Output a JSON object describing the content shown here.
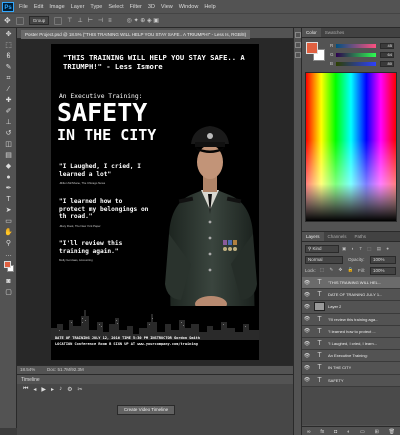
{
  "app": {
    "logo": "Ps",
    "menu": [
      "File",
      "Edit",
      "Image",
      "Layer",
      "Type",
      "Select",
      "Filter",
      "3D",
      "View",
      "Window",
      "Help"
    ]
  },
  "options": {
    "tool_icon": "move-tool-icon",
    "auto_select": "Group"
  },
  "document": {
    "tab_label": "Poster Project.psd @ 18.5% (\"THIS TRAINING WILL HELP YOU STAY SAFE.. A TRIUMPH!\" - Less Is, RGB/8)",
    "zoom": "18.54%",
    "doc_size": "Doc: 51.7M/92.3M"
  },
  "poster": {
    "quote": "\"THIS TRAINING WILL HELP YOU STAY SAFE.. A TRIUMPH!\"  - Less Ismore",
    "subtitle": "An Executive Training:",
    "title_line1": "SAFETY",
    "title_line2": "IN THE CITY",
    "testimonials": [
      {
        "text": "\"I Laughed, I cried, I learned a lot\"",
        "attribution": "-Milton McShane, The Chicago News"
      },
      {
        "text": "\"I learned how to protect my belongings on th road.\"",
        "attribution": "-Mary Rook, The New York Paper"
      },
      {
        "text": "\"I'll review this training again.\"",
        "attribution": "Molly Gonzaas, Accounting"
      }
    ],
    "details_line1": "DATE OF TRAINING JULY 12, 2016 TIME 5:30 PM INSTRUCTOR Gordon Smith",
    "details_line2": "LOCATION Conference Room B SIGN UP AT www.yourcompany.com/training"
  },
  "timeline": {
    "title": "Timeline",
    "create_button": "Create Video Timeline"
  },
  "color_panel": {
    "tabs": [
      "Color",
      "Swatches"
    ],
    "fg_color": "#e06040",
    "bg_color": "#ffffff",
    "sliders": [
      {
        "label": "R",
        "value": "45"
      },
      {
        "label": "G",
        "value": "64"
      },
      {
        "label": "B",
        "value": "80"
      }
    ]
  },
  "layers_panel": {
    "tabs": [
      "Layers",
      "Channels",
      "Paths"
    ],
    "filter_label": "Kind",
    "blend_mode": "Normal",
    "opacity_label": "Opacity:",
    "opacity": "100%",
    "lock_label": "Lock:",
    "fill_label": "Fill:",
    "fill": "100%",
    "layers": [
      {
        "name": "\"THIS TRAINING WILL HEL...",
        "kind": "text",
        "selected": true
      },
      {
        "name": "DATE OF TRAINING JULY 1...",
        "kind": "text",
        "selected": false
      },
      {
        "name": "Layer 2",
        "kind": "image",
        "selected": false
      },
      {
        "name": "\"I'll review this training aga...",
        "kind": "text",
        "selected": false
      },
      {
        "name": "\"I learned how to protect ...",
        "kind": "text",
        "selected": false
      },
      {
        "name": "\"I Laughed, I cried, I learn...",
        "kind": "text",
        "selected": false
      },
      {
        "name": "An Executive Training:",
        "kind": "text",
        "selected": false
      },
      {
        "name": "IN THE CITY",
        "kind": "text",
        "selected": false
      },
      {
        "name": "SAFETY",
        "kind": "text",
        "selected": false
      }
    ],
    "footer_icons": [
      "link-icon",
      "fx-icon",
      "mask-icon",
      "adjustment-icon",
      "folder-icon",
      "new-layer-icon",
      "trash-icon"
    ]
  }
}
